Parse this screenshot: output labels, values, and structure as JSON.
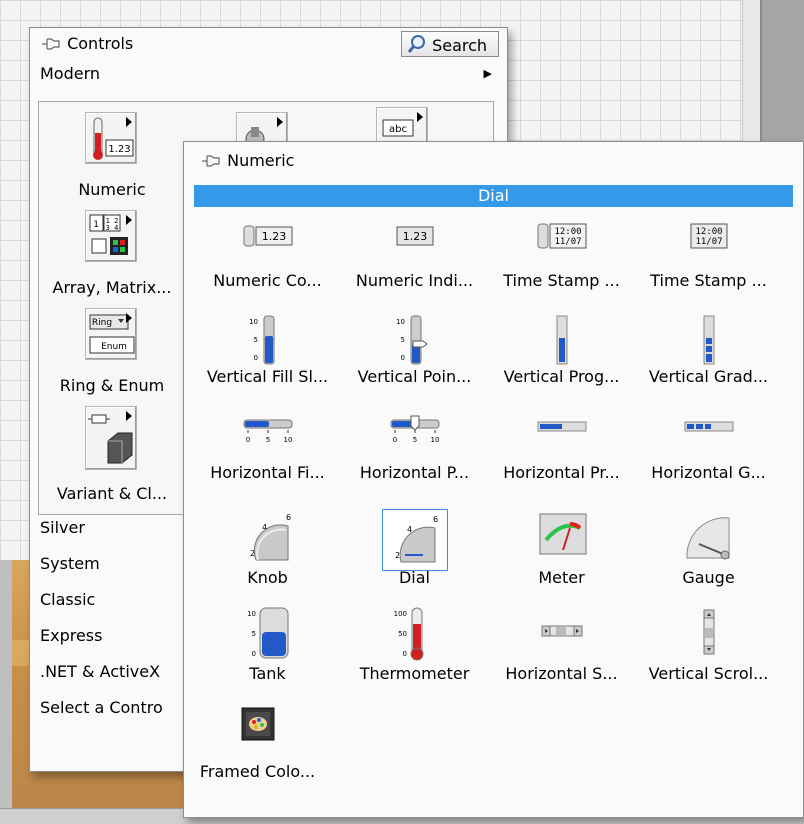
{
  "controls_palette": {
    "title": "Controls",
    "search_label": "Search",
    "current_category": "Modern",
    "modern_categories": [
      {
        "label": "Numeric",
        "icon": "numeric-category-icon"
      },
      {
        "label": "Array, Matrix...",
        "icon": "array-matrix-category-icon"
      },
      {
        "label": "Ring & Enum",
        "icon": "ring-enum-category-icon"
      },
      {
        "label": "Variant & Cl...",
        "icon": "variant-class-category-icon"
      }
    ],
    "other_categories": [
      "Silver",
      "System",
      "Classic",
      "Express",
      ".NET & ActiveX",
      "Select a Contro"
    ]
  },
  "numeric_palette": {
    "title": "Numeric",
    "selected_tooltip": "Dial",
    "items": [
      {
        "label": "Numeric Co...",
        "icon": "numeric-control-icon"
      },
      {
        "label": "Numeric Indi...",
        "icon": "numeric-indicator-icon"
      },
      {
        "label": "Time Stamp ...",
        "icon": "time-stamp-control-icon",
        "text": "12:00 11/07"
      },
      {
        "label": "Time Stamp ...",
        "icon": "time-stamp-indicator-icon",
        "text": "12:00 11/07"
      },
      {
        "label": "Vertical Fill Sl...",
        "icon": "vertical-fill-slide-icon"
      },
      {
        "label": "Vertical Poin...",
        "icon": "vertical-pointer-slide-icon"
      },
      {
        "label": "Vertical Prog...",
        "icon": "vertical-progress-bar-icon"
      },
      {
        "label": "Vertical Grad...",
        "icon": "vertical-graduated-bar-icon"
      },
      {
        "label": "Horizontal Fi...",
        "icon": "horizontal-fill-slide-icon"
      },
      {
        "label": "Horizontal P...",
        "icon": "horizontal-pointer-slide-icon"
      },
      {
        "label": "Horizontal Pr...",
        "icon": "horizontal-progress-bar-icon"
      },
      {
        "label": "Horizontal G...",
        "icon": "horizontal-graduated-bar-icon"
      },
      {
        "label": "Knob",
        "icon": "knob-icon"
      },
      {
        "label": "Dial",
        "icon": "dial-icon",
        "selected": true
      },
      {
        "label": "Meter",
        "icon": "meter-icon"
      },
      {
        "label": "Gauge",
        "icon": "gauge-icon"
      },
      {
        "label": "Tank",
        "icon": "tank-icon"
      },
      {
        "label": "Thermometer",
        "icon": "thermometer-icon"
      },
      {
        "label": "Horizontal S...",
        "icon": "horizontal-scrollbar-icon"
      },
      {
        "label": "Vertical Scrol...",
        "icon": "vertical-scrollbar-icon"
      },
      {
        "label": "Framed Colo...",
        "icon": "framed-color-box-icon"
      }
    ],
    "icon_texts": {
      "numeric_value": "1.23",
      "time_line1": "12:00",
      "time_line2": "11/07",
      "scale_10": "10",
      "scale_5": "5",
      "scale_0": "0",
      "scale_100": "100",
      "scale_50": "50",
      "knob_6": "6",
      "knob_4": "4",
      "knob_2": "2",
      "enum_label": "Enum",
      "ring_label": "Ring",
      "abc_label": "abc"
    }
  },
  "colors": {
    "tooltip_bar": "#3399e8",
    "fill_blue": "#2159c9",
    "thermo_red": "#d12020"
  }
}
